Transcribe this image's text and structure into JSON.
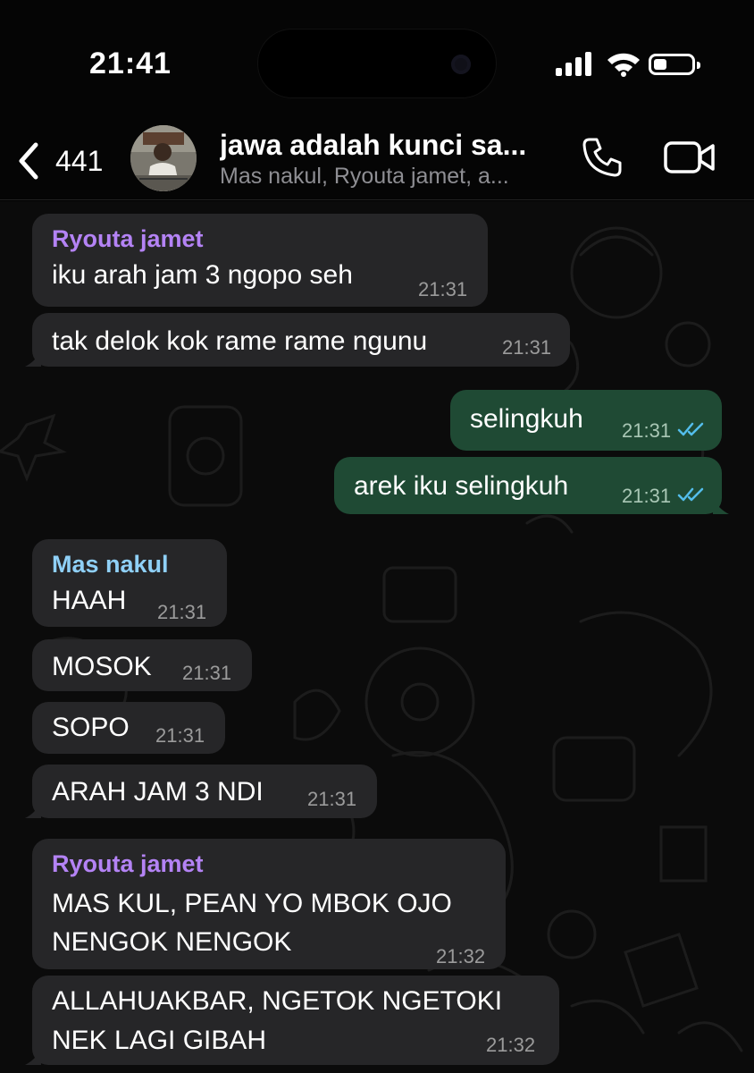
{
  "status": {
    "time": "21:41"
  },
  "header": {
    "back_count": "441",
    "title": "jawa adalah kunci sa...",
    "subtitle": "Mas nakul, Ryouta jamet, a..."
  },
  "messages": [
    {
      "sender": "Ryouta jamet",
      "text": "iku arah jam 3 ngopo seh",
      "time": "21:31"
    },
    {
      "text": "tak delok kok rame rame ngunu",
      "time": "21:31"
    },
    {
      "text": "selingkuh",
      "time": "21:31",
      "outgoing": true,
      "status": "read"
    },
    {
      "text": "arek iku selingkuh",
      "time": "21:31",
      "outgoing": true,
      "status": "read"
    },
    {
      "sender": "Mas nakul",
      "text": "HAAH",
      "time": "21:31"
    },
    {
      "text": "MOSOK",
      "time": "21:31"
    },
    {
      "text": "SOPO",
      "time": "21:31"
    },
    {
      "text": "ARAH JAM 3 NDI",
      "time": "21:31"
    },
    {
      "sender": "Ryouta jamet",
      "text_line1": "MAS KUL, PEAN YO MBOK OJO",
      "text_line2": "NENGOK NENGOK",
      "time": "21:32"
    },
    {
      "text_line1": "ALLAHUAKBAR, NGETOK NGETOKI",
      "text_line2": "NEK LAGI GIBAH",
      "time": "21:32"
    }
  ],
  "colors": {
    "incoming_bubble": "#262628",
    "outgoing_bubble": "#1f4a34",
    "sender_purple": "#b483f5",
    "sender_blue": "#8fd0f7",
    "read_ticks": "#53bdeb"
  },
  "icons": [
    "back-chevron-icon",
    "phone-icon",
    "video-camera-icon",
    "signal-icon",
    "wifi-icon",
    "battery-icon",
    "double-check-icon"
  ]
}
